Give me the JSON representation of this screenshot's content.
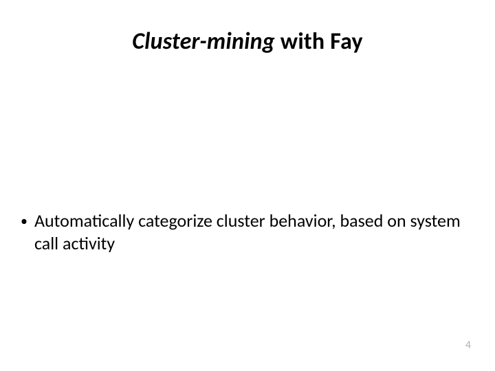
{
  "title": {
    "italic": "Cluster-mining",
    "regular": " with Fay"
  },
  "bullets": [
    {
      "text": "Automatically categorize cluster behavior, based on system call activity"
    }
  ],
  "page_number": "4"
}
